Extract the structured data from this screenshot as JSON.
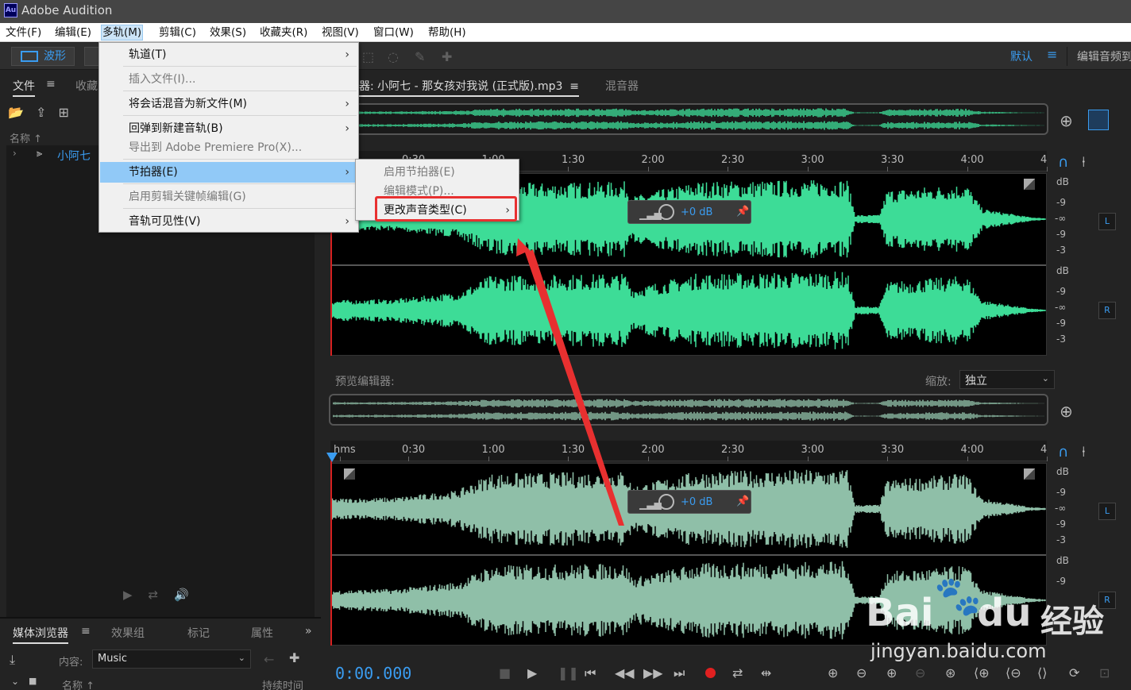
{
  "app": {
    "logo": "Au",
    "title": "Adobe Audition"
  },
  "menubar": [
    "文件(F)",
    "编辑(E)",
    "多轨(M)",
    "剪辑(C)",
    "效果(S)",
    "收藏夹(R)",
    "视图(V)",
    "窗口(W)",
    "帮助(H)"
  ],
  "toolbar": {
    "waveform_label": "波形",
    "workspace": "默认",
    "workspace_edit": "编辑音频到"
  },
  "files_panel": {
    "tab": "文件",
    "tab_other": "收藏",
    "column_name": "名称",
    "file_name": "小阿七"
  },
  "media_panel": {
    "tabs": [
      "媒体浏览器",
      "效果组",
      "标记",
      "属性"
    ],
    "content_label": "内容:",
    "content_value": "Music",
    "col_name": "名称",
    "col_duration": "持续时间"
  },
  "editor": {
    "tab_title": "器: 小阿七 - 那女孩对我说 (正式版).mp3",
    "mixer_tab": "混音器",
    "ruler_top": [
      "0:30",
      "1:00",
      "1:30",
      "2:00",
      "2:30",
      "3:00",
      "3:30",
      "4:00",
      "4"
    ],
    "ruler_bottom": [
      "hms",
      "0:30",
      "1:00",
      "1:30",
      "2:00",
      "2:30",
      "3:00",
      "3:30",
      "4:00",
      "4"
    ],
    "db_labels": [
      "dB",
      "-9",
      "-∞",
      "-9",
      "-3"
    ],
    "left_channel": "L",
    "right_channel": "R",
    "hud_value": "+0 dB",
    "preview_label": "预览编辑器:",
    "scale_label": "缩放:",
    "scale_value": "独立",
    "time": "0:00.000"
  },
  "multitrack_menu": {
    "items": [
      {
        "label": "轨道(T)",
        "arrow": "›",
        "disabled": false
      },
      {
        "label": "插入文件(I)...",
        "arrow": "",
        "disabled": true
      },
      {
        "label": "将会话混音为新文件(M)",
        "arrow": "›",
        "disabled": false
      },
      {
        "label": "回弹到新建音轨(B)",
        "arrow": "›",
        "disabled": false
      },
      {
        "label": "导出到 Adobe Premiere Pro(X)...",
        "arrow": "",
        "disabled": true
      },
      {
        "label": "节拍器(E)",
        "arrow": "›",
        "disabled": false
      },
      {
        "label": "启用剪辑关键帧编辑(G)",
        "arrow": "",
        "disabled": true
      },
      {
        "label": "音轨可见性(V)",
        "arrow": "›",
        "disabled": false
      }
    ]
  },
  "metronome_submenu": {
    "items": [
      {
        "label": "启用节拍器(E)",
        "disabled": true
      },
      {
        "label": "编辑模式(P)...",
        "disabled": true
      },
      {
        "label": "更改声音类型(C)",
        "disabled": false,
        "arrow": "›"
      }
    ]
  },
  "watermark": {
    "text": "jingyan.baidu.com",
    "brand": "Bai",
    "brand2": "du",
    "brand3": "经验"
  },
  "colors": {
    "accent": "#3a9cf0",
    "wave_active": "#3ddc97",
    "wave_preview": "#8fbfa8",
    "highlight": "#e83030"
  }
}
